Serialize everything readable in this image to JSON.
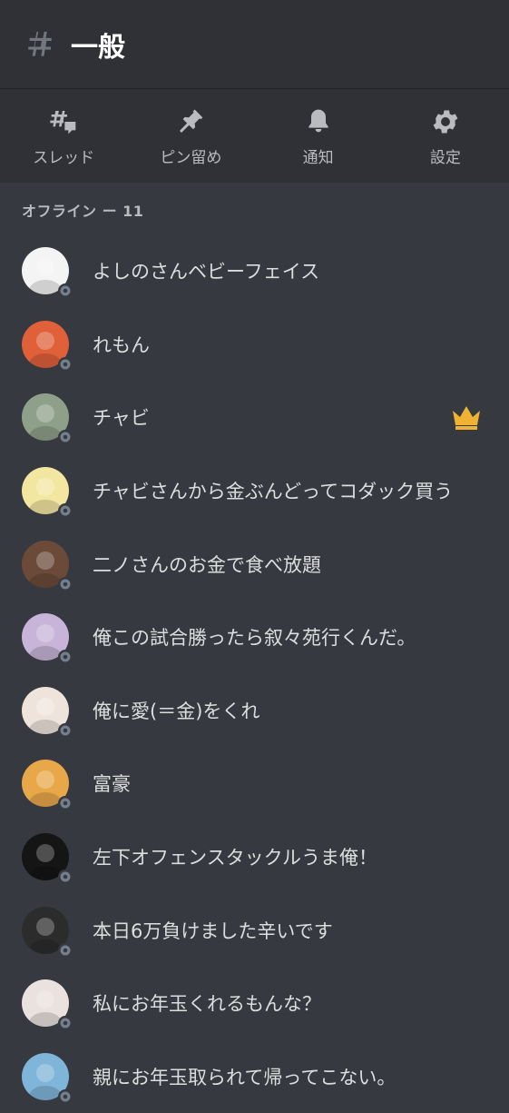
{
  "channel": {
    "title": "一般",
    "icon": "hash-icon"
  },
  "toolbar": [
    {
      "label": "スレッド",
      "icon": "threads-icon"
    },
    {
      "label": "ピン留め",
      "icon": "pin-icon"
    },
    {
      "label": "通知",
      "icon": "bell-icon"
    },
    {
      "label": "設定",
      "icon": "gear-icon"
    }
  ],
  "section": {
    "title": "オフライン ー 11"
  },
  "members": [
    {
      "name": "よしのさんベビーフェイス",
      "avatar_color": "#f4f4f4",
      "owner": false
    },
    {
      "name": "れもん",
      "avatar_color": "#e0603a",
      "owner": false
    },
    {
      "name": "チャビ",
      "avatar_color": "#8fa08a",
      "owner": true
    },
    {
      "name": "チャビさんから金ぶんどってコダック買う",
      "avatar_color": "#f2e6a0",
      "owner": false
    },
    {
      "name": "二ノさんのお金で食べ放題",
      "avatar_color": "#6b4a3a",
      "owner": false
    },
    {
      "name": "俺この試合勝ったら叙々苑行くんだ。",
      "avatar_color": "#c7b4d8",
      "owner": false
    },
    {
      "name": "俺に愛(＝金)をくれ",
      "avatar_color": "#efe4dc",
      "owner": false
    },
    {
      "name": "富豪",
      "avatar_color": "#e8a84a",
      "owner": false
    },
    {
      "name": "左下オフェンスタックルうま俺！",
      "avatar_color": "#151515",
      "owner": false
    },
    {
      "name": "本日6万負けました辛いです",
      "avatar_color": "#2c2c2c",
      "owner": false
    },
    {
      "name": "私にお年玉くれるもんな？",
      "avatar_color": "#e9e2de",
      "owner": false
    },
    {
      "name": "親にお年玉取られて帰ってこない。",
      "avatar_color": "#7fb5d9",
      "owner": false
    }
  ],
  "colors": {
    "status_offline": "#747f8d",
    "crown": "#f0b232"
  }
}
